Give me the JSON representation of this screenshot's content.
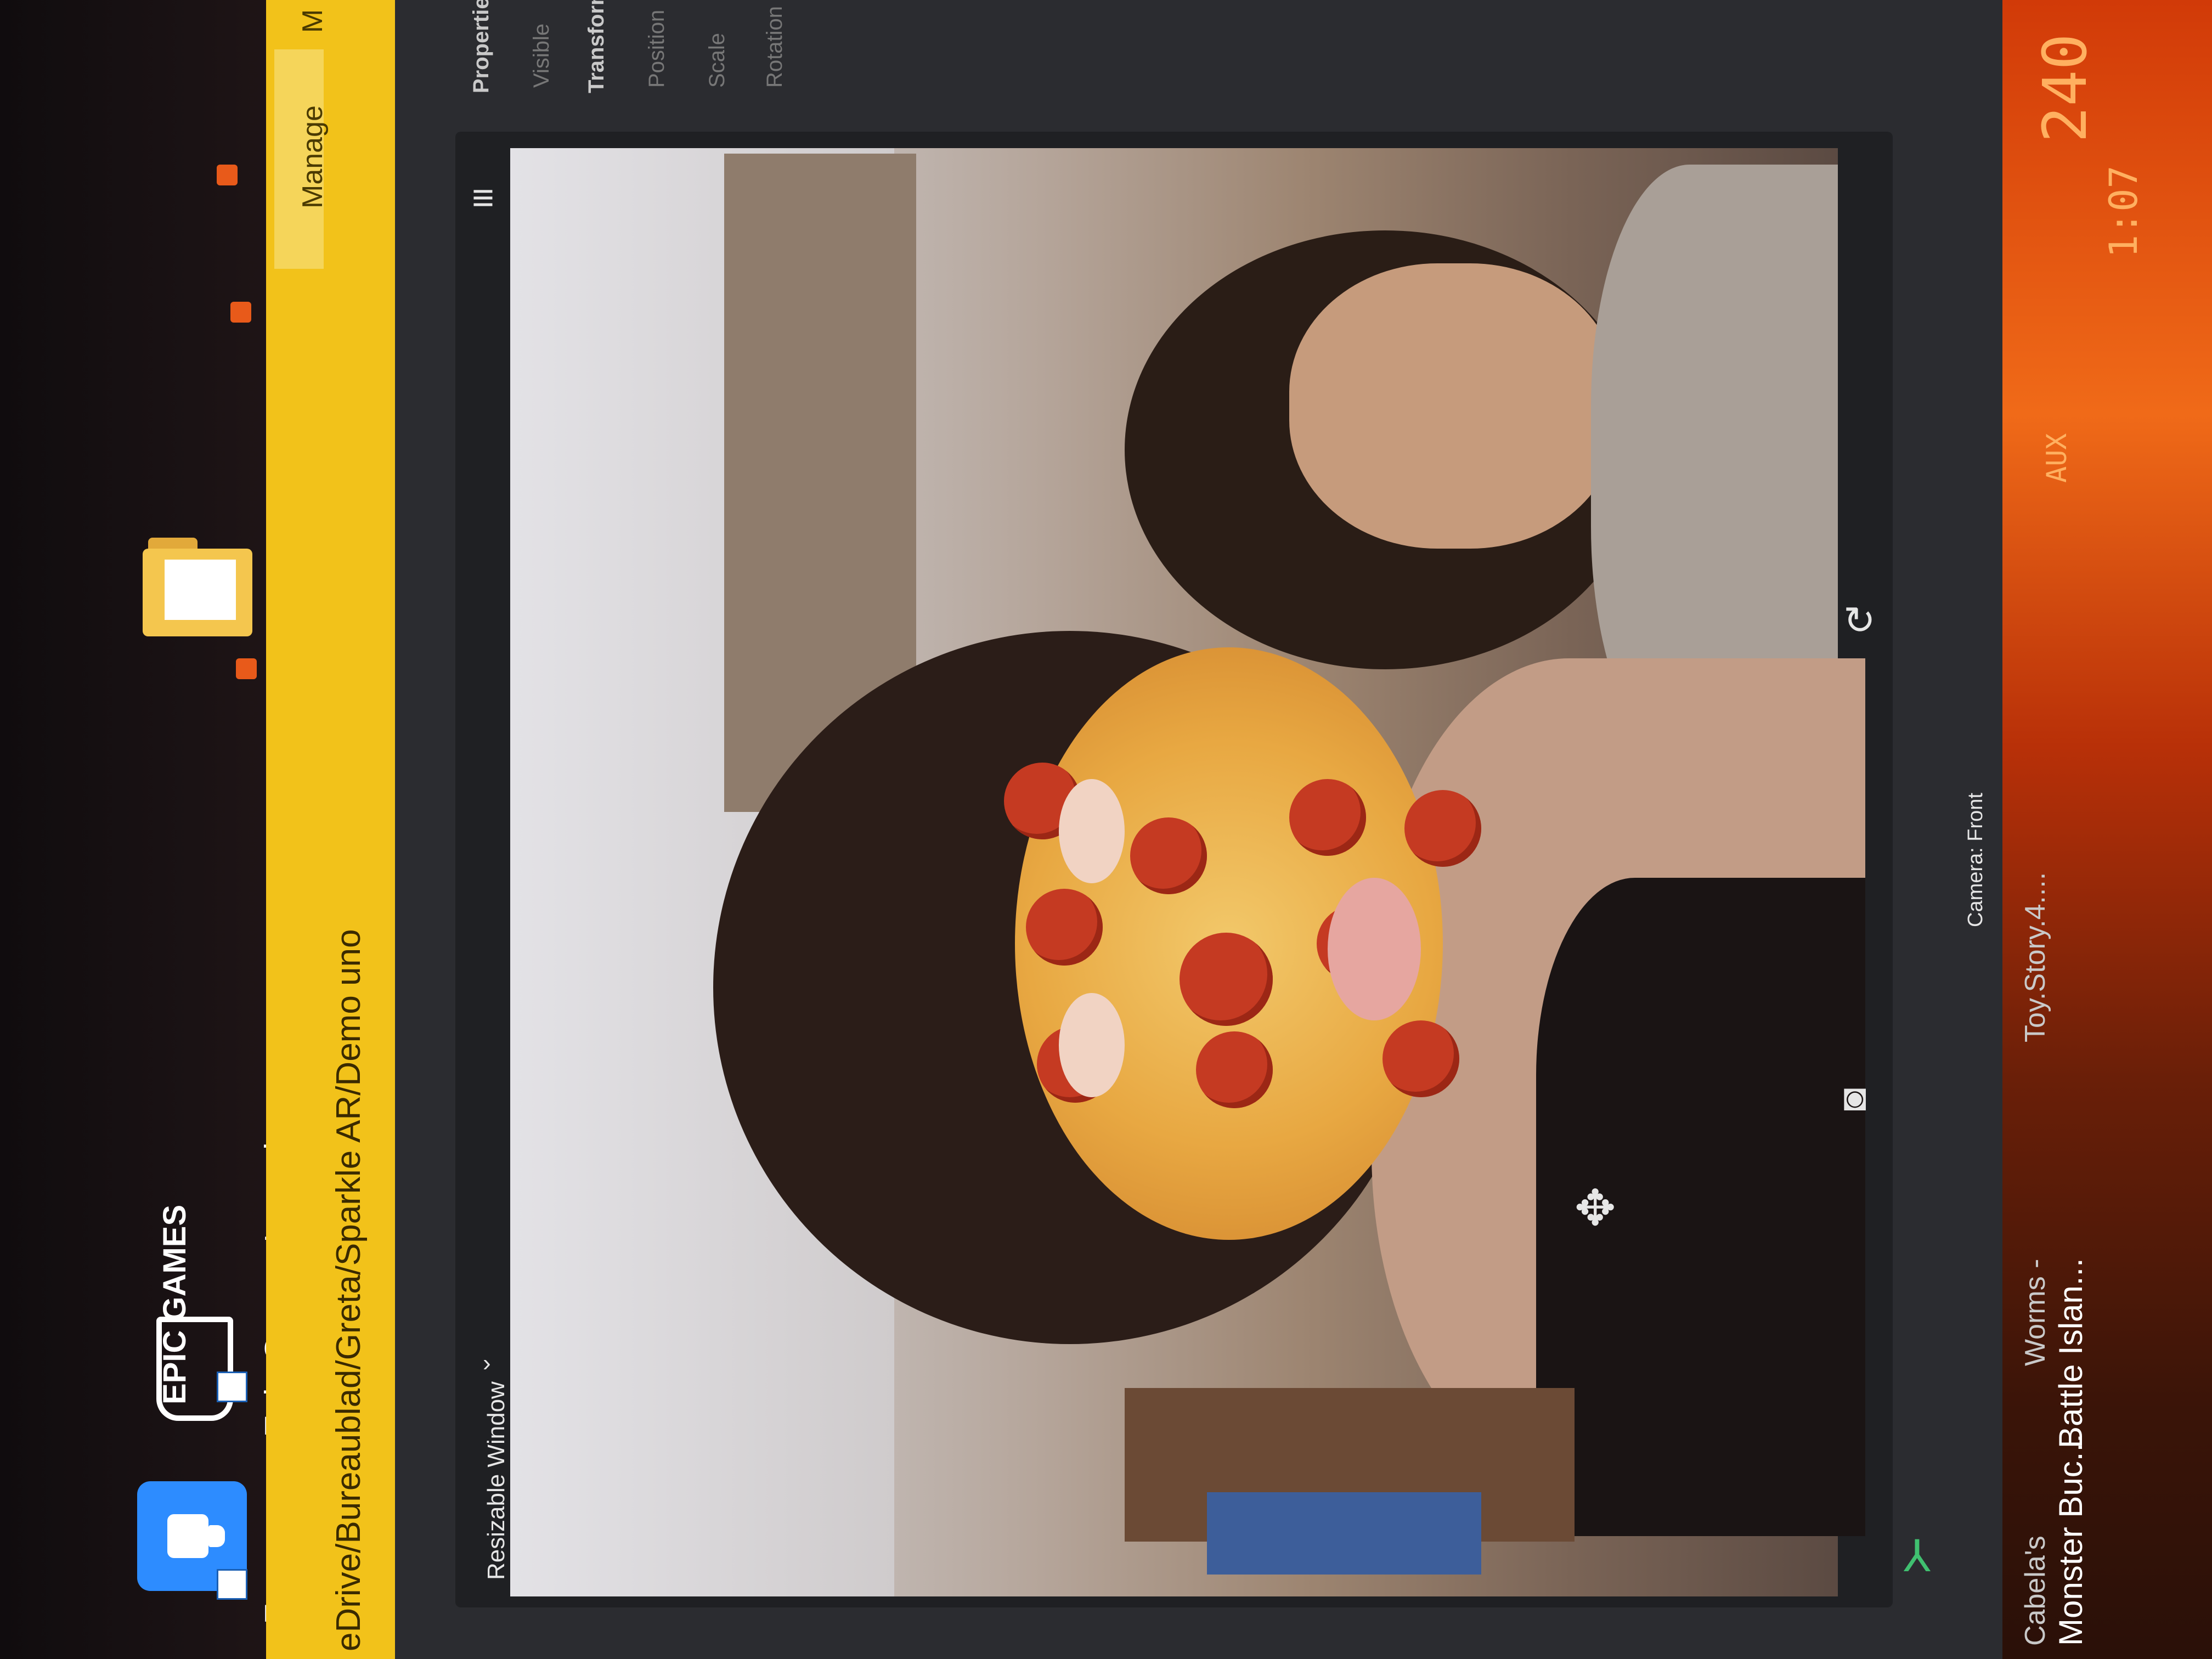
{
  "desktop": {
    "icons": [
      {
        "name": "Zoom",
        "type": "zoom"
      },
      {
        "name": "Epic Games Launcher",
        "type": "epic",
        "logo_text": "EPIC GAMES"
      }
    ]
  },
  "explorer": {
    "path": "eDrive/Bureaublad/Greta/Sparkle AR/Demo uno",
    "ribbon_tab": "Manage",
    "ribbon_tab_cut": "M"
  },
  "spark_ar": {
    "viewport": {
      "window_selector": "Resizable Window",
      "camera_label": "Camera: Front",
      "menu_icon": "hamburger-icon",
      "move_icon": "move-arrows-icon",
      "capture_icon": "camera-capture-icon",
      "rotate_icon": "rotate-icon"
    },
    "properties": {
      "section_properties": "Propertie",
      "visible_label": "Visible",
      "section_transform": "Transform",
      "position_label": "Position",
      "scale_label": "Scale",
      "rotation_label": "Rotation"
    }
  },
  "taskbar": {
    "items": [
      "Cabela's",
      "Monster Buc...",
      "Worms -",
      "Battle Islan...",
      "Toy.Story.4...."
    ]
  },
  "dashboard": {
    "readout_top": "240",
    "readout_time": "1:07",
    "readout_label": "AUX"
  },
  "colors": {
    "explorer_accent": "#f2c21a",
    "zoom_blue": "#2d8cff",
    "editor_bg": "#2b2c30",
    "dashboard_orange": "#f06a18"
  }
}
